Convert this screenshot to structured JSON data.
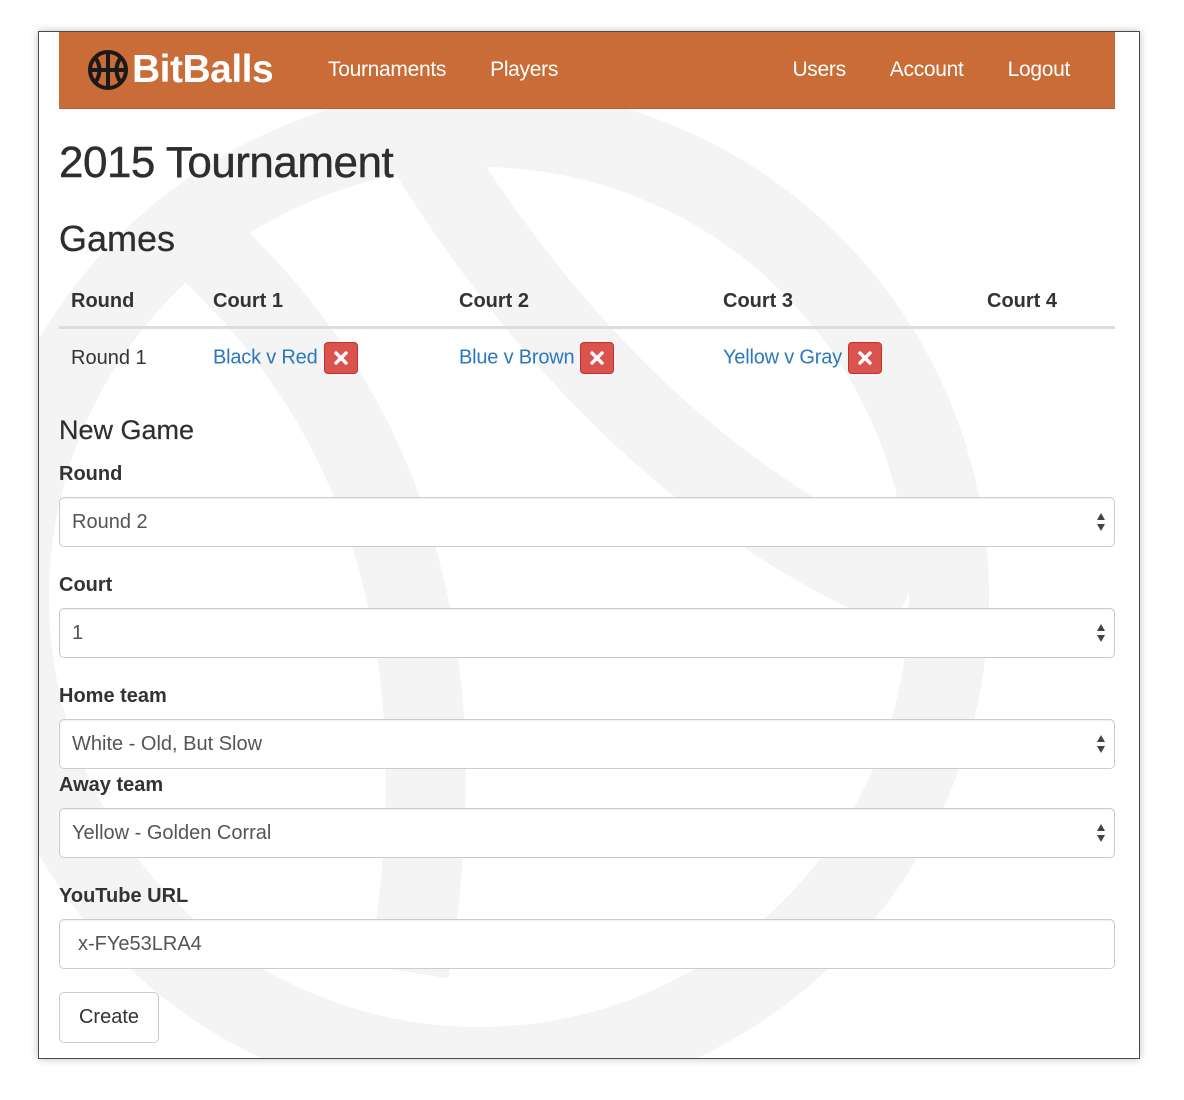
{
  "navbar": {
    "brand": "BitBalls",
    "left_links": [
      "Tournaments",
      "Players"
    ],
    "right_links": [
      "Users",
      "Account",
      "Logout"
    ],
    "color": "#c96c37"
  },
  "page": {
    "title": "2015 Tournament",
    "games_heading": "Games"
  },
  "games_table": {
    "headers": [
      "Round",
      "Court 1",
      "Court 2",
      "Court 3",
      "Court 4"
    ],
    "rows": [
      {
        "round": "Round 1",
        "court1": "Black v Red",
        "court2": "Blue v Brown",
        "court3": "Yellow v Gray",
        "court4": ""
      }
    ]
  },
  "new_game": {
    "heading": "New Game",
    "round": {
      "label": "Round",
      "value": "Round 2"
    },
    "court": {
      "label": "Court",
      "value": "1"
    },
    "home_team": {
      "label": "Home team",
      "value": "White - Old, But Slow"
    },
    "away_team": {
      "label": "Away team",
      "value": "Yellow - Golden Corral"
    },
    "youtube_url": {
      "label": "YouTube URL",
      "value": "x-FYe53LRA4"
    },
    "submit_label": "Create"
  },
  "colors": {
    "link": "#2a78bd",
    "danger": "#d9534f"
  },
  "icons": {
    "brand": "basketball-icon",
    "delete": "close-icon",
    "select": "select-arrows-icon"
  }
}
